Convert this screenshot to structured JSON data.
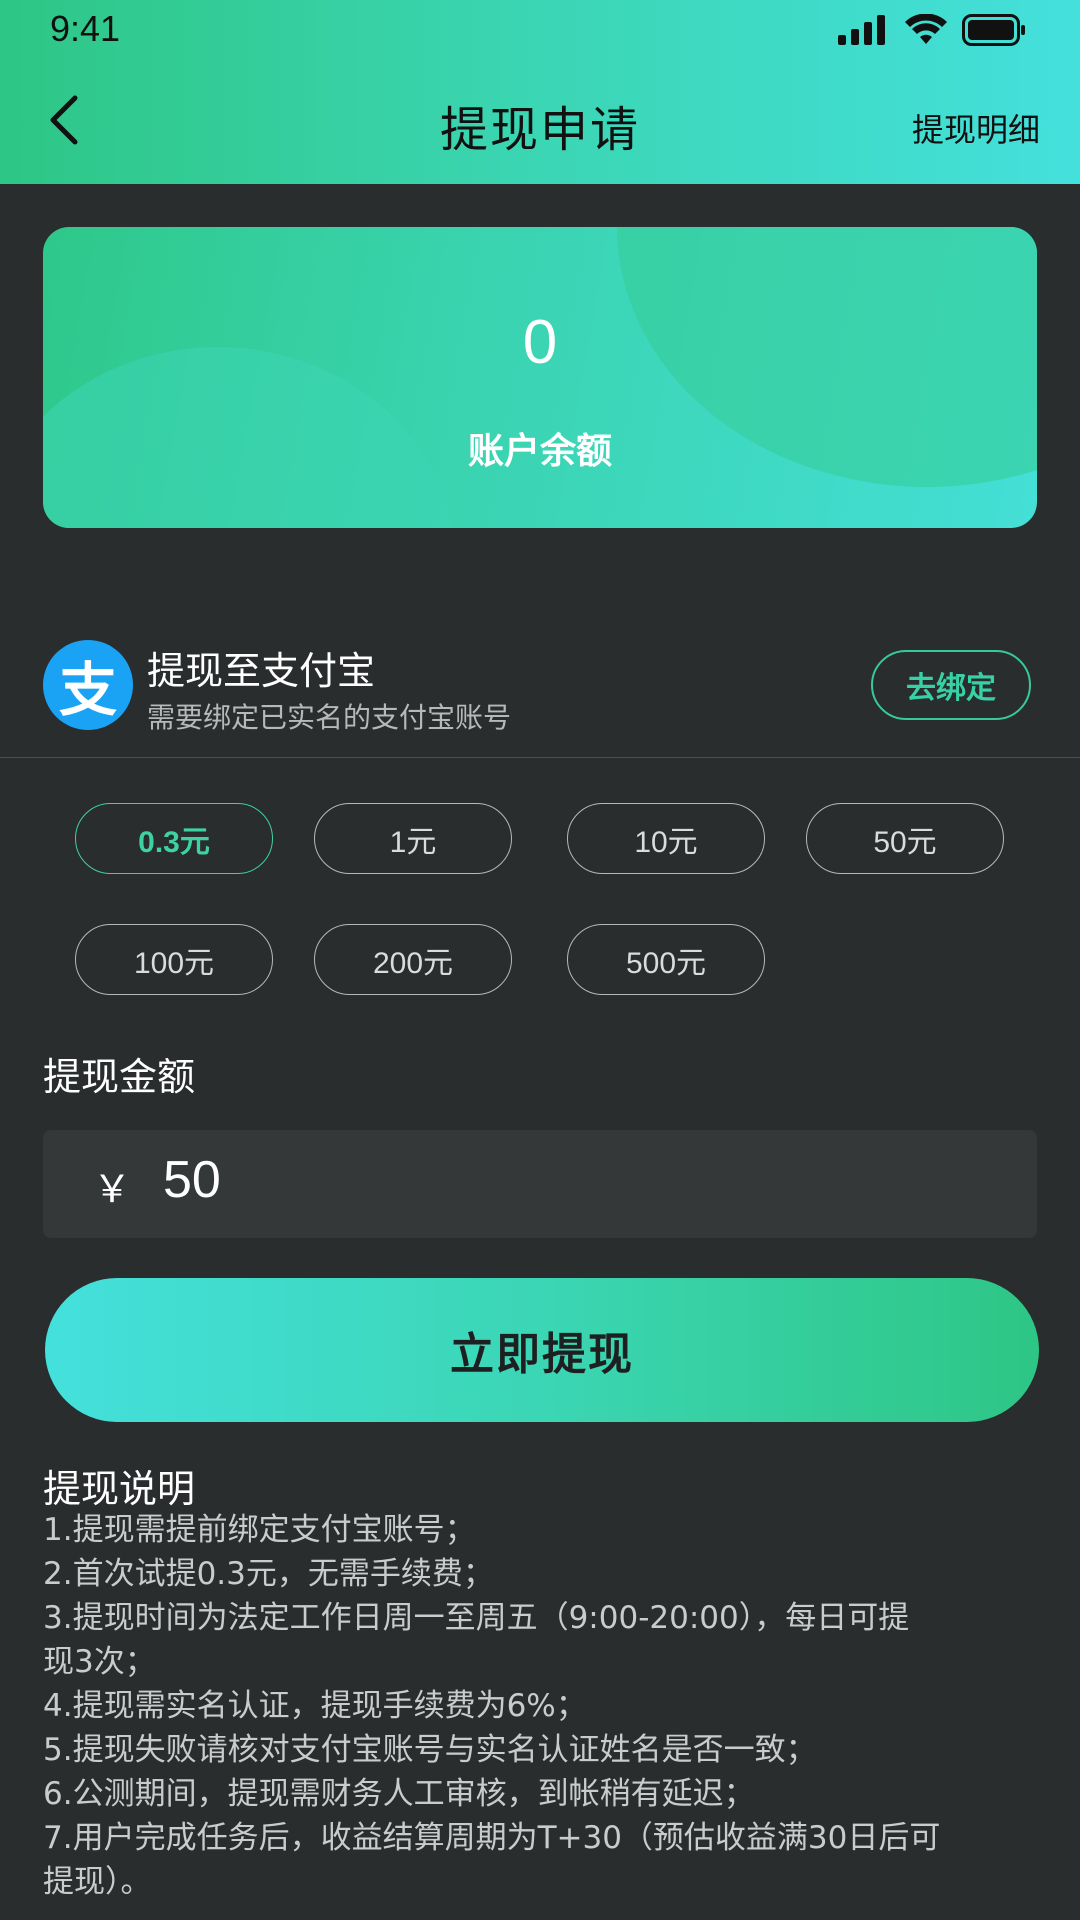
{
  "status_bar": {
    "time": "9:41"
  },
  "header": {
    "title": "提现申请",
    "detail_link": "提现明细"
  },
  "balance": {
    "value": "0",
    "label": "账户余额"
  },
  "alipay": {
    "logo_char": "支",
    "title": "提现至支付宝",
    "subtitle": "需要绑定已实名的支付宝账号",
    "bind_label": "去绑定"
  },
  "amount_options": [
    "0.3元",
    "1元",
    "10元",
    "50元",
    "100元",
    "200元",
    "500元"
  ],
  "selected_option_index": 0,
  "withdraw": {
    "label": "提现金额",
    "currency": "￥",
    "amount": "50"
  },
  "submit_label": "立即提现",
  "notes": {
    "title": "提现说明",
    "lines": [
      "1.提现需提前绑定支付宝账号；",
      "2.首次试提0.3元，无需手续费；",
      "3.提现时间为法定工作日周一至周五（9:00-20:00），每日可提",
      "现3次；",
      "4.提现需实名认证，提现手续费为6%；",
      "5.提现失败请核对支付宝账号与实名认证姓名是否一致；",
      "6.公测期间，提现需财务人工审核，到帐稍有延迟；",
      "7.用户完成任务后，收益结算周期为T+30（预估收益满30日后可",
      "提现）。"
    ]
  },
  "colors": {
    "accent": "#3ed2a3",
    "gradient_start": "#2ec685",
    "gradient_end": "#44e0dc",
    "background": "#292d2e",
    "alipay_blue": "#1aa3f5"
  },
  "icons": {
    "back": "chevron-left-icon",
    "signal": "signal-icon",
    "wifi": "wifi-icon",
    "battery": "battery-icon"
  }
}
